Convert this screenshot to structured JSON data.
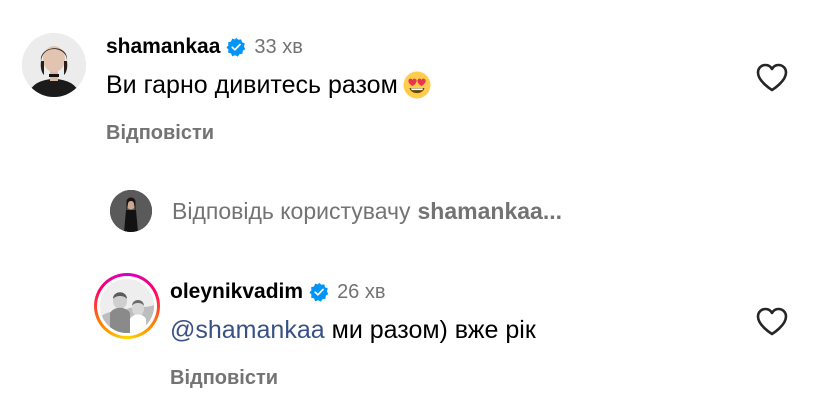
{
  "comments": [
    {
      "username": "shamankaa",
      "verified": true,
      "time": "33 хв",
      "text": "Ви гарно дивитесь разом",
      "emoji": "heart-eyes-emoji",
      "reply_label": "Відповісти"
    },
    {
      "username": "oleynikvadim",
      "verified": true,
      "time": "26 хв",
      "mention": "@shamankaa",
      "text": "ми разом) вже рік",
      "reply_label": "Відповісти"
    }
  ],
  "reply_bar": {
    "prompt": "Відповідь користувачу",
    "user": "shamankaa..."
  },
  "colors": {
    "verified": "#0095f6",
    "secondary_text": "#737373",
    "mention": "#385185"
  },
  "icons": {
    "like": "heart-outline-icon",
    "verified": "verified-badge-icon"
  }
}
